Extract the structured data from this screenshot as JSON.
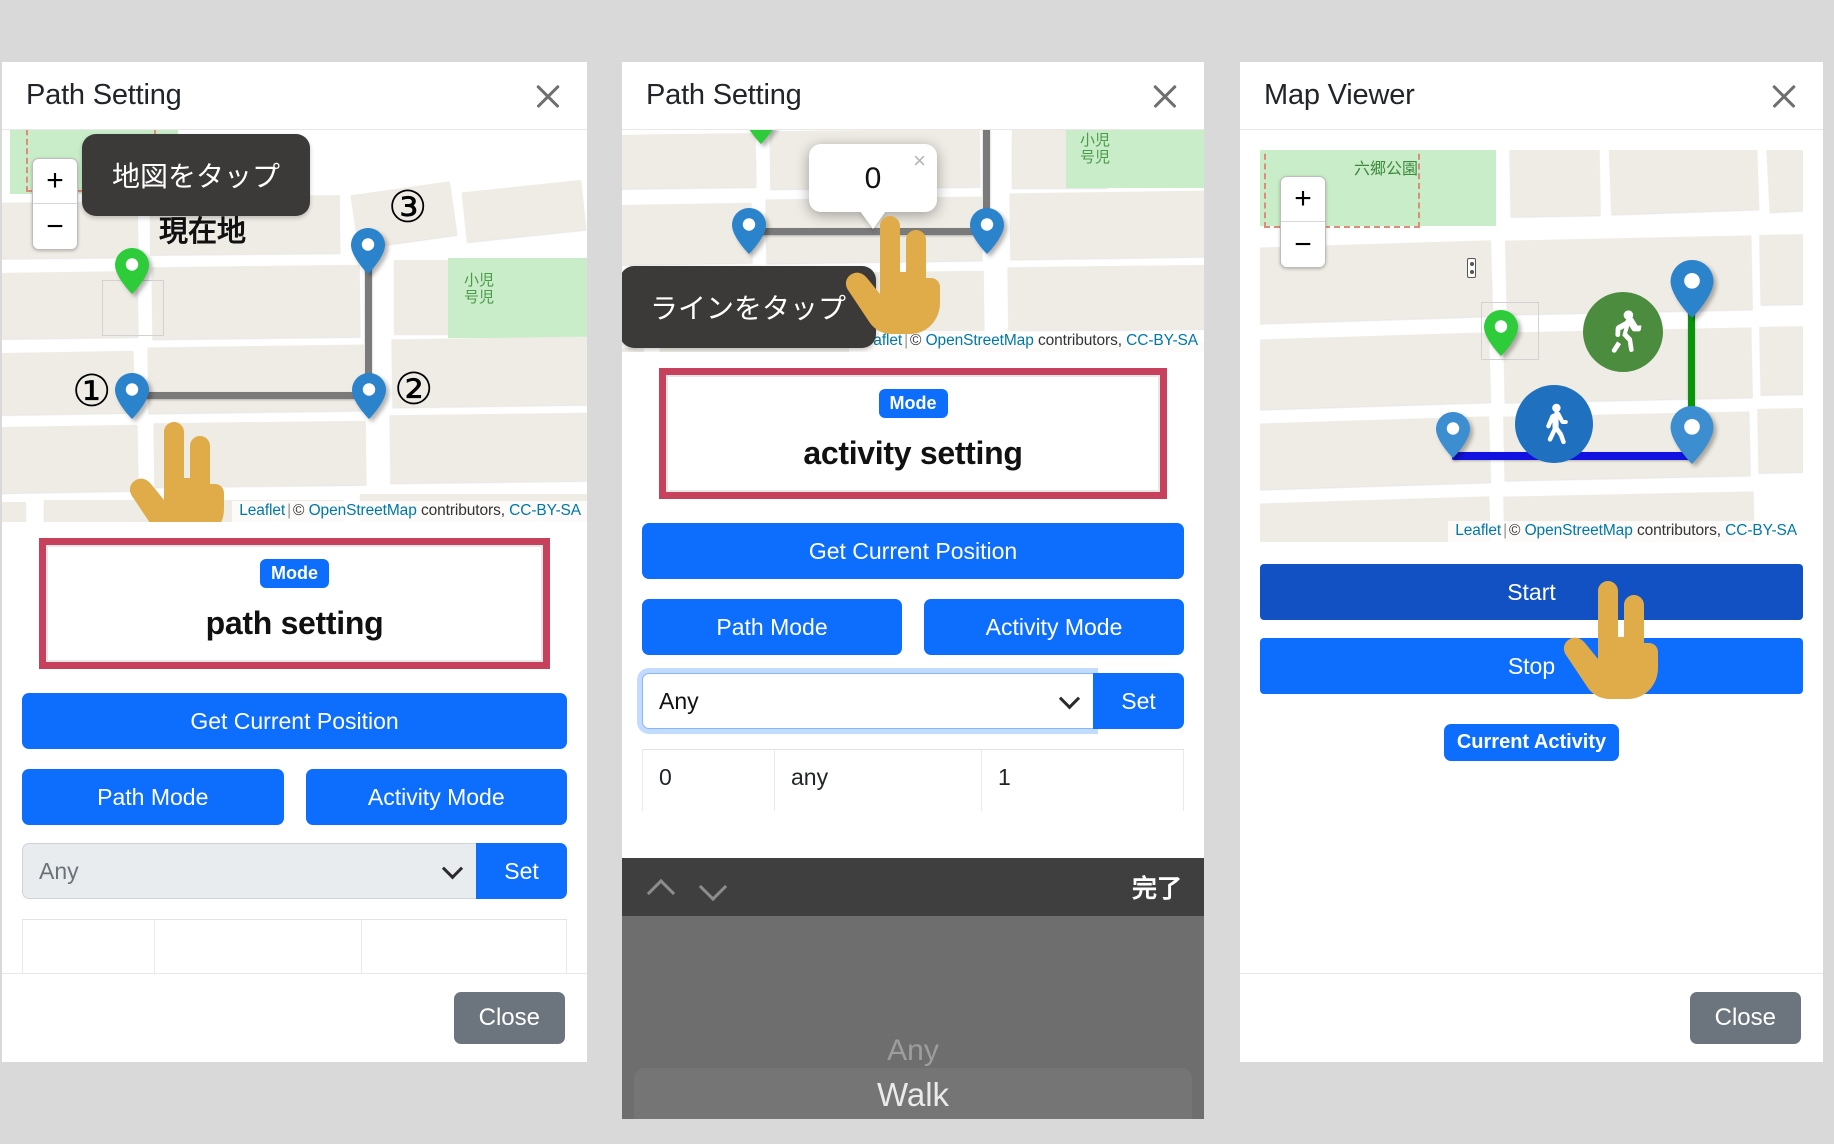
{
  "panels": [
    {
      "title": "Path Setting",
      "coach_tip": "地図をタップ",
      "map_labels": {
        "current_location": "現在地",
        "green_label": "小児\n号児"
      },
      "markers": [
        {
          "num": "①",
          "color": "blue"
        },
        {
          "num": "②",
          "color": "blue"
        },
        {
          "num": "③",
          "color": "blue"
        },
        {
          "num": "",
          "color": "green"
        }
      ],
      "attribution": {
        "leaflet": "Leaflet",
        "copy": "©",
        "osm": "OpenStreetMap",
        "contrib": "contributors,",
        "license": "CC-BY-SA"
      },
      "mode_badge": "Mode",
      "mode_value": "path setting",
      "get_position_label": "Get Current Position",
      "path_mode_label": "Path Mode",
      "activity_mode_label": "Activity Mode",
      "select_value": "Any",
      "set_label": "Set",
      "close_label": "Close",
      "zoom_in": "+",
      "zoom_out": "−"
    },
    {
      "title": "Path Setting",
      "coach_tip": "ラインをタップ",
      "balloon_value": "0",
      "balloon_close": "×",
      "map_labels": {
        "green_label": "小児\n号児"
      },
      "attribution": {
        "leaflet": "Leaflet",
        "copy": "©",
        "osm": "OpenStreetMap",
        "contrib": "contributors,",
        "license": "CC-BY-SA"
      },
      "mode_badge": "Mode",
      "mode_value": "activity setting",
      "get_position_label": "Get Current Position",
      "path_mode_label": "Path Mode",
      "activity_mode_label": "Activity Mode",
      "select_value": "Any",
      "set_label": "Set",
      "table_row": [
        "0",
        "any",
        "1"
      ],
      "picker": {
        "done_label": "完了",
        "dim_option": "Any",
        "selected_option": "Walk"
      }
    },
    {
      "title": "Map Viewer",
      "map_labels": {
        "park": "六郷公園"
      },
      "attribution": {
        "leaflet": "Leaflet",
        "copy": "©",
        "osm": "OpenStreetMap",
        "contrib": "contributors,",
        "license": "CC-BY-SA"
      },
      "start_label": "Start",
      "stop_label": "Stop",
      "current_activity_label": "Current Activity",
      "close_label": "Close",
      "zoom_in": "+",
      "zoom_out": "−"
    }
  ],
  "colors": {
    "primary": "#0d6efd",
    "start": "#1151c3",
    "highlight_border": "#c8415c",
    "grey_button": "#6c757d",
    "pin_blue": "#2b83cb",
    "pin_green": "#2ecc3a",
    "route_grey": "#7a7a7a",
    "route_green": "#089509",
    "route_blue": "#1212e0",
    "page_bg": "#d9d9d9"
  }
}
